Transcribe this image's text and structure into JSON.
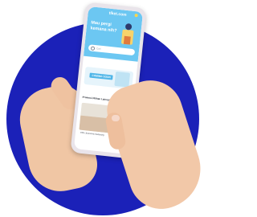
{
  "app": {
    "logo": "tiket.com",
    "hero_title": "Mau pergi kemana nih?",
    "search_placeholder": "Cari",
    "promo_badge": "COMING SOON",
    "section_title": "Promosi Pilihan Lainnya",
    "section_link": "Lihat Semua",
    "card_caption": "Pilih Liburanmu Sekarang"
  },
  "icons": {
    "search": "search-icon",
    "notification": "notification-icon"
  },
  "colors": {
    "background_circle": "#1b21b8",
    "header": "#6cc7f2",
    "accent": "#4fb6e8"
  }
}
